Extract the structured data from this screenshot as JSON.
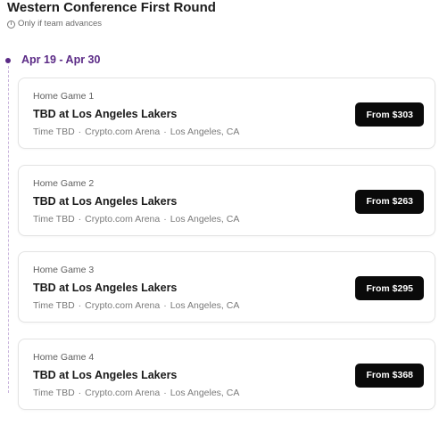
{
  "header": {
    "title": "Western Conference First Round",
    "note": "Only if team advances",
    "note_icon": "info-icon"
  },
  "timeline": {
    "date_range": "Apr 19 - Apr 30",
    "accent_color": "#5b2a86"
  },
  "games": [
    {
      "label": "Home Game 1",
      "matchup": "TBD at Los Angeles Lakers",
      "time": "Time TBD",
      "venue": "Crypto.com Arena",
      "city": "Los Angeles, CA",
      "price": "From $303"
    },
    {
      "label": "Home Game 2",
      "matchup": "TBD at Los Angeles Lakers",
      "time": "Time TBD",
      "venue": "Crypto.com Arena",
      "city": "Los Angeles, CA",
      "price": "From $263"
    },
    {
      "label": "Home Game 3",
      "matchup": "TBD at Los Angeles Lakers",
      "time": "Time TBD",
      "venue": "Crypto.com Arena",
      "city": "Los Angeles, CA",
      "price": "From $295"
    },
    {
      "label": "Home Game 4",
      "matchup": "TBD at Los Angeles Lakers",
      "time": "Time TBD",
      "venue": "Crypto.com Arena",
      "city": "Los Angeles, CA",
      "price": "From $368"
    }
  ],
  "separator": "·"
}
